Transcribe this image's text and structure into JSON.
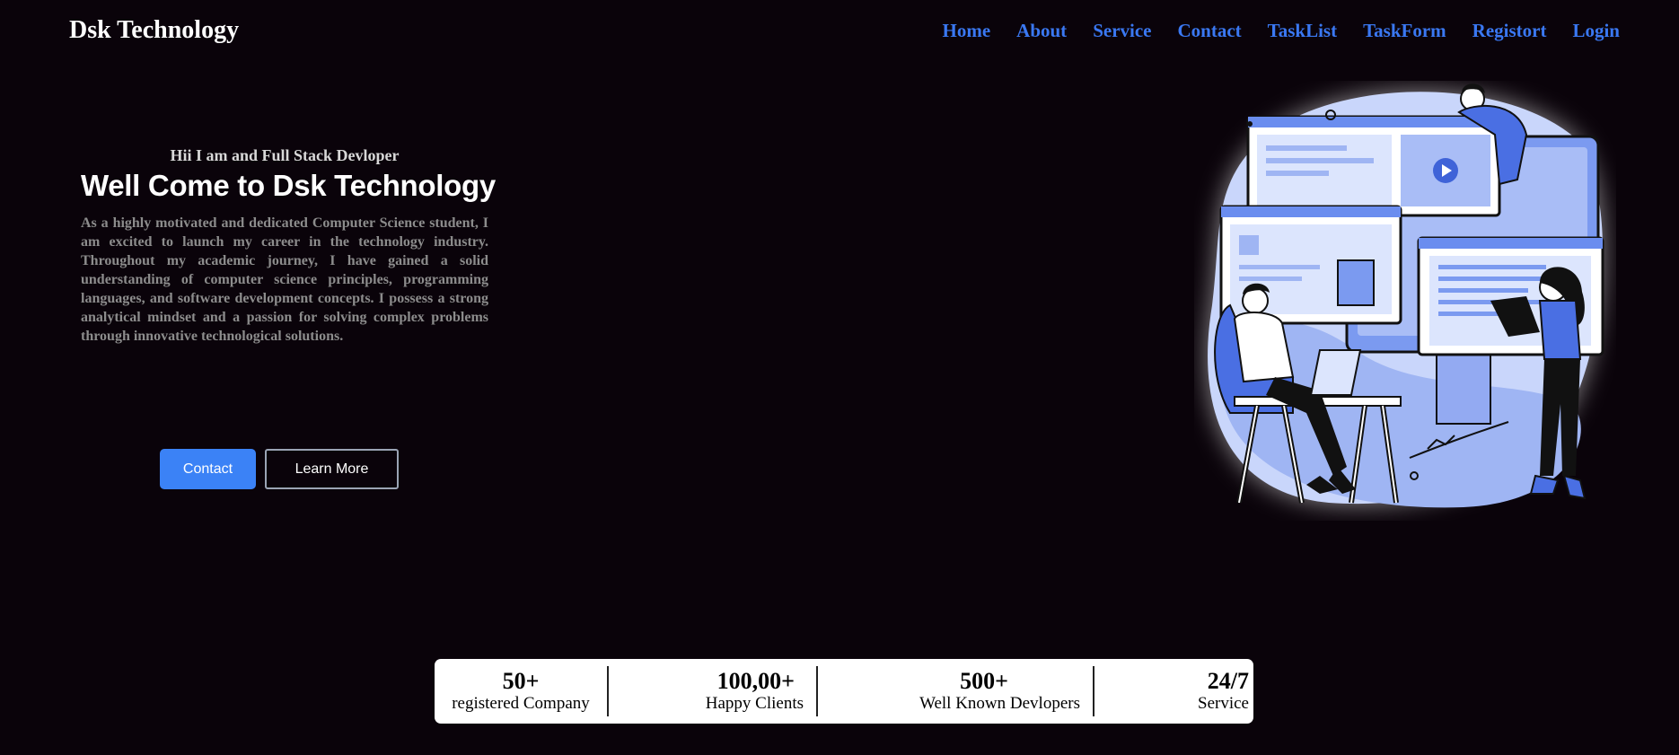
{
  "brand": "Dsk Technology",
  "nav": [
    "Home",
    "About",
    "Service",
    "Contact",
    "TaskList",
    "TaskForm",
    "Registort",
    "Login"
  ],
  "hero": {
    "subtitle": "Hii I am and Full Stack Devloper",
    "title": "Well Come to Dsk Technology",
    "intro": "As a highly motivated and dedicated Computer Science student, I am excited to launch my career in the technology industry. Throughout my academic journey, I have gained a solid understanding of computer science principles, programming languages, and software development concepts. I possess a strong analytical mindset and a passion for solving complex problems through innovative technological solutions."
  },
  "buttons": {
    "contact": "Contact",
    "learn_more": "Learn More"
  },
  "stats": [
    {
      "value": "50+",
      "label": "registered Company"
    },
    {
      "value": "100,00+",
      "label": "Happy Clients"
    },
    {
      "value": "500+",
      "label": "Well Known Devlopers"
    },
    {
      "value": "24/7",
      "label": "Service"
    }
  ],
  "colors": {
    "background": "#0a030a",
    "nav_link": "#3a78f2",
    "primary_button": "#3b82f6"
  },
  "illustration": "people-working-on-screens-illustration"
}
